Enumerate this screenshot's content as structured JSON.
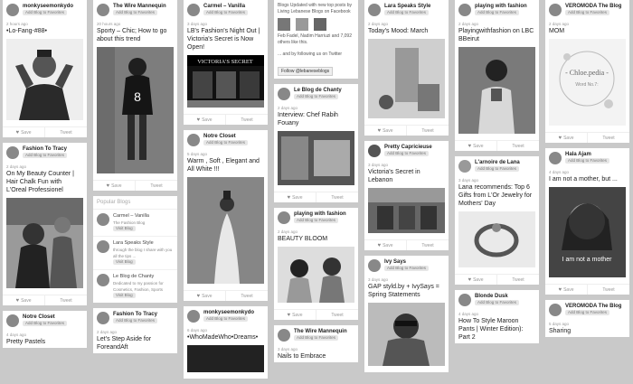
{
  "board_pill": "Add Blog to Favorites",
  "save_label": "Save",
  "tweet_label": "Tweet",
  "c1": {
    "a": {
      "author": "monkyseemonkydo",
      "time": "2 hours ago",
      "title": "•Lo-Fang-#88•"
    },
    "b": {
      "author": "Fashion To Tracy",
      "time": "2 days ago",
      "title": "On My Beauty Counter | Hair Chalk Fun with L'Oreal Professionel"
    },
    "c": {
      "author": "Notre Closet",
      "time": "4 days ago",
      "title": "Pretty Pastels"
    }
  },
  "c2": {
    "a": {
      "author": "The Wire Mannequin",
      "time": "20 hours ago",
      "title": "Sporty – Chic; How to go about this trend",
      "jersey": "8"
    },
    "b": {
      "header": "Popular Blogs",
      "items": [
        {
          "name": "Carmel – Vanilla",
          "desc": "The Fashion Blog"
        },
        {
          "name": "Lara Speaks Style",
          "desc": "through the blog I share with you all the tips ..."
        },
        {
          "name": "Le Blog de Chanty",
          "desc": "Dedicated to my passion for Cosmetics, Fashion, Sports"
        }
      ],
      "visit": "Visit Blog"
    },
    "c": {
      "author": "Fashion To Tracy",
      "time": "2 days ago",
      "title": "Let's Step Aside for ForeandAft"
    }
  },
  "c3": {
    "a": {
      "author": "Carmel – Vanilla",
      "time": "3 days ago",
      "title": "LB's Fashion's Night Out | Victoria's Secret is Now Open!",
      "store_sign": "VICTORIA'S SECRET"
    },
    "b": {
      "author": "Notre Closet",
      "time": "5 days ago",
      "title": "Warm , Soft , Elegant and All White !!!"
    },
    "c": {
      "author": "monkyseemonkydo",
      "time": "6 days ago",
      "title": "•WhoMadeWho•Dreams•"
    }
  },
  "c4": {
    "a": {
      "text": "Blogs Updated with new top posts by Living Lebanese Blogs on Facebook",
      "text2": "Feb Fadel, Nadim Harriuzi and 7,092 others like this.",
      "text3": "... and by following us on Twitter",
      "follow": "Follow @lebaneseblogs"
    },
    "b": {
      "author": "Le Blog de Chanty",
      "time": "2 days ago",
      "title": "Interview: Chef Rabih Fouany"
    },
    "c": {
      "author": "playing with fashion",
      "time": "2 days ago",
      "title": "BEAUTY BLOOM"
    },
    "d": {
      "author": "The Wire Mannequin",
      "time": "3 days ago",
      "title": "Nails to Embrace"
    }
  },
  "c5": {
    "a": {
      "author": "Lara Speaks Style",
      "time": "2 days ago",
      "title": "Today's Mood: March"
    },
    "b": {
      "author": "Pretty Capricieuse",
      "time": "3 days ago",
      "title": "Victoria's Secret in Lebanon"
    },
    "c": {
      "author": "Ivy Says",
      "time": "3 days ago",
      "title": "GAP styld.by + IvySays = Spring Statements"
    }
  },
  "c6": {
    "a": {
      "author": "playing with fashion",
      "time": "2 days ago",
      "title": "Playingwithfashion on LBC BBeirut"
    },
    "b": {
      "author": "L'arnoire de Lana",
      "time": "3 days ago",
      "title": "Lana recommends: Top 6 Gifts from L'Or Jewelry for Mothers' Day"
    },
    "c": {
      "author": "Blonde Dusk",
      "time": "4 days ago",
      "title": "How To Style Maroon Pants | Winter Edition): Part 2"
    }
  },
  "c7": {
    "a": {
      "author": "VEROMODA The Blog",
      "time": "2 days ago",
      "title": "MOM",
      "overlay": "- Chloe.pedia -",
      "overlay2": "Word No.7:"
    },
    "b": {
      "author": "Hala Ajam",
      "time": "4 days ago",
      "title": "I am not a mother, but ...",
      "overlay": "I am not a mother"
    },
    "c": {
      "author": "VEROMODA The Blog",
      "time": "5 days ago",
      "title": "Sharing"
    }
  }
}
